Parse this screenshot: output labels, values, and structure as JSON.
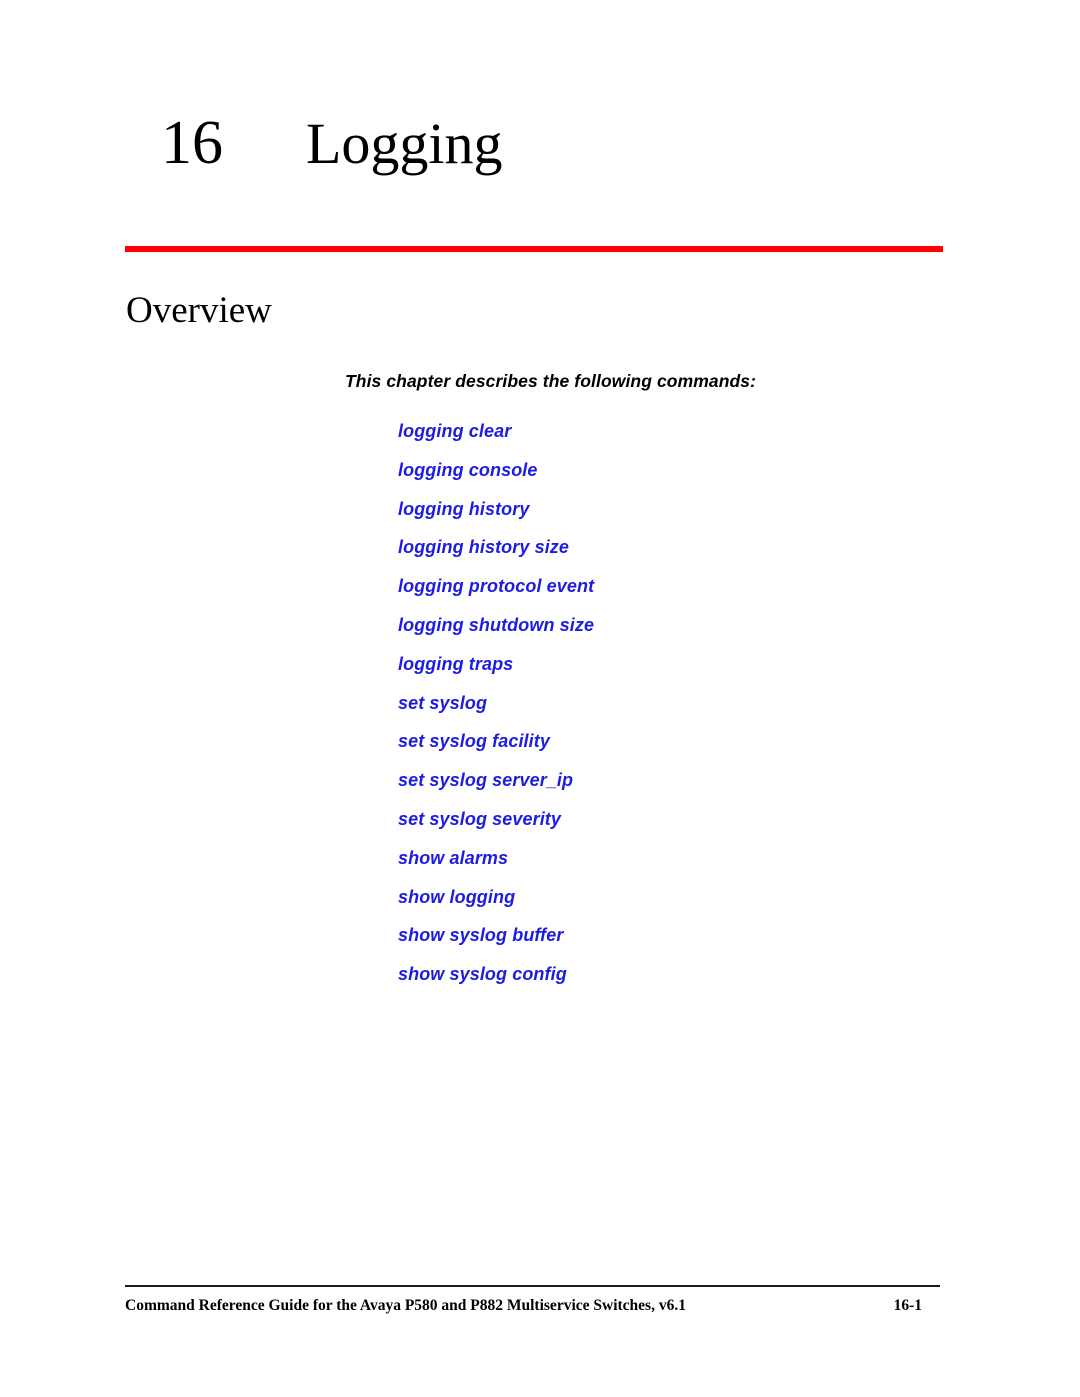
{
  "document": {
    "chapter_number": "16",
    "chapter_title": "Logging"
  },
  "section": {
    "heading": "Overview",
    "intro": "This chapter describes the following commands:"
  },
  "colors": {
    "rule_red": "#ff0000",
    "link_blue": "#1d1de2",
    "text_black": "#000000",
    "footer_rule": "#1a1a1a"
  },
  "commands": [
    {
      "label": "logging clear"
    },
    {
      "label": "logging console"
    },
    {
      "label": "logging history"
    },
    {
      "label": "logging history size"
    },
    {
      "label": "logging protocol event"
    },
    {
      "label": "logging shutdown size"
    },
    {
      "label": "logging traps"
    },
    {
      "label": "set syslog"
    },
    {
      "label": "set syslog facility"
    },
    {
      "label": "set syslog server_ip"
    },
    {
      "label": "set syslog severity"
    },
    {
      "label": "show alarms"
    },
    {
      "label": "show logging"
    },
    {
      "label": "show syslog buffer"
    },
    {
      "label": "show syslog config"
    }
  ],
  "footer": {
    "text": "Command Reference Guide for the Avaya P580 and P882 Multiservice Switches, v6.1",
    "page_number": "16-1"
  }
}
